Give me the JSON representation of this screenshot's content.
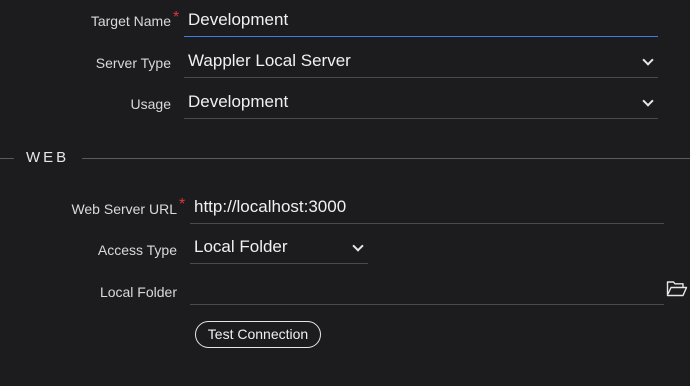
{
  "general": {
    "target_name": {
      "label": "Target Name",
      "required": "*",
      "value": "Development"
    },
    "server_type": {
      "label": "Server Type",
      "value": "Wappler Local Server"
    },
    "usage": {
      "label": "Usage",
      "value": "Development"
    }
  },
  "web": {
    "section_title": "WEB",
    "web_server_url": {
      "label": "Web Server URL",
      "required": "*",
      "value": "http://localhost:3000"
    },
    "access_type": {
      "label": "Access Type",
      "value": "Local Folder"
    },
    "local_folder": {
      "label": "Local Folder",
      "value": "",
      "icon": "folder-open-icon"
    },
    "test_button_label": "Test Connection"
  },
  "colors": {
    "background": "#1c1c1f",
    "focus_underline": "#3d7fe0",
    "required": "#e0343a"
  }
}
